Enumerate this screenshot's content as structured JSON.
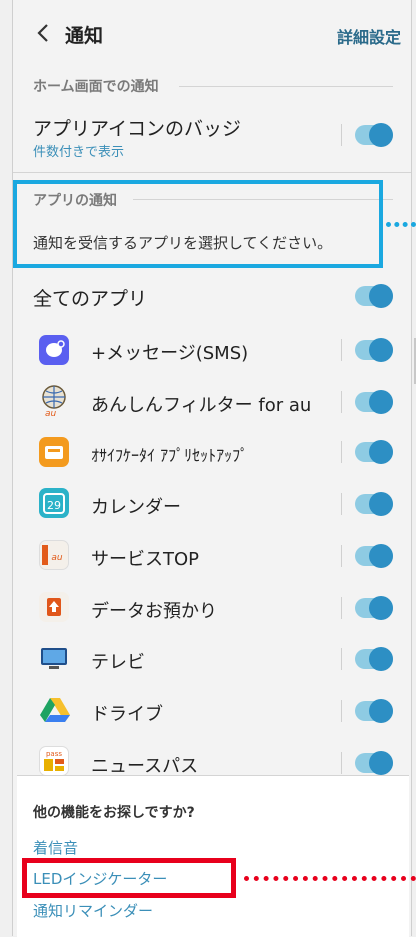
{
  "header": {
    "title": "通知",
    "detail_settings": "詳細設定"
  },
  "home_section": {
    "heading": "ホーム画面での通知",
    "badge_title": "アプリアイコンのバッジ",
    "badge_subtitle": "件数付きで表示"
  },
  "apps_section": {
    "heading": "アプリの通知",
    "description": "通知を受信するアプリを選択してください。",
    "all_apps": "全てのアプリ"
  },
  "apps": [
    {
      "label": "+メッセージ(SMS)",
      "icon": "message-icon",
      "color": "#5a5ff0"
    },
    {
      "label": "あんしんフィルター for au",
      "icon": "anshin-filter-icon",
      "color": "#8a6a3a"
    },
    {
      "label": "ｵｻｲﾌｹｰﾀｲ ｱﾌﾟﾘｾｯﾄｱｯﾌﾟ",
      "icon": "osaifu-icon",
      "color": "#f39a1e"
    },
    {
      "label": "カレンダー",
      "icon": "calendar-icon",
      "color": "#2bb2c8",
      "icon_text": "29"
    },
    {
      "label": "サービスTOP",
      "icon": "service-top-icon",
      "color": "#e25b1a",
      "icon_text": "au"
    },
    {
      "label": "データお預かり",
      "icon": "data-backup-icon",
      "color": "#e0561a"
    },
    {
      "label": "テレビ",
      "icon": "tv-icon",
      "color": "#3a7fc1"
    },
    {
      "label": "ドライブ",
      "icon": "drive-icon",
      "color": "#1ea362"
    },
    {
      "label": "ニュースパス",
      "icon": "newspass-icon",
      "color": "#e8b000",
      "icon_text": "pass"
    }
  ],
  "toggles": {
    "state": "on",
    "track_color": "#8ecbe3",
    "knob_color": "#2d8fc4"
  },
  "bottom": {
    "heading": "他の機能をお探しですか?",
    "links": [
      "着信音",
      "LEDインジケーター",
      "通知リマインダー"
    ]
  },
  "annotations": {
    "blue": "#1aa8e0",
    "red": "#e8001c"
  }
}
